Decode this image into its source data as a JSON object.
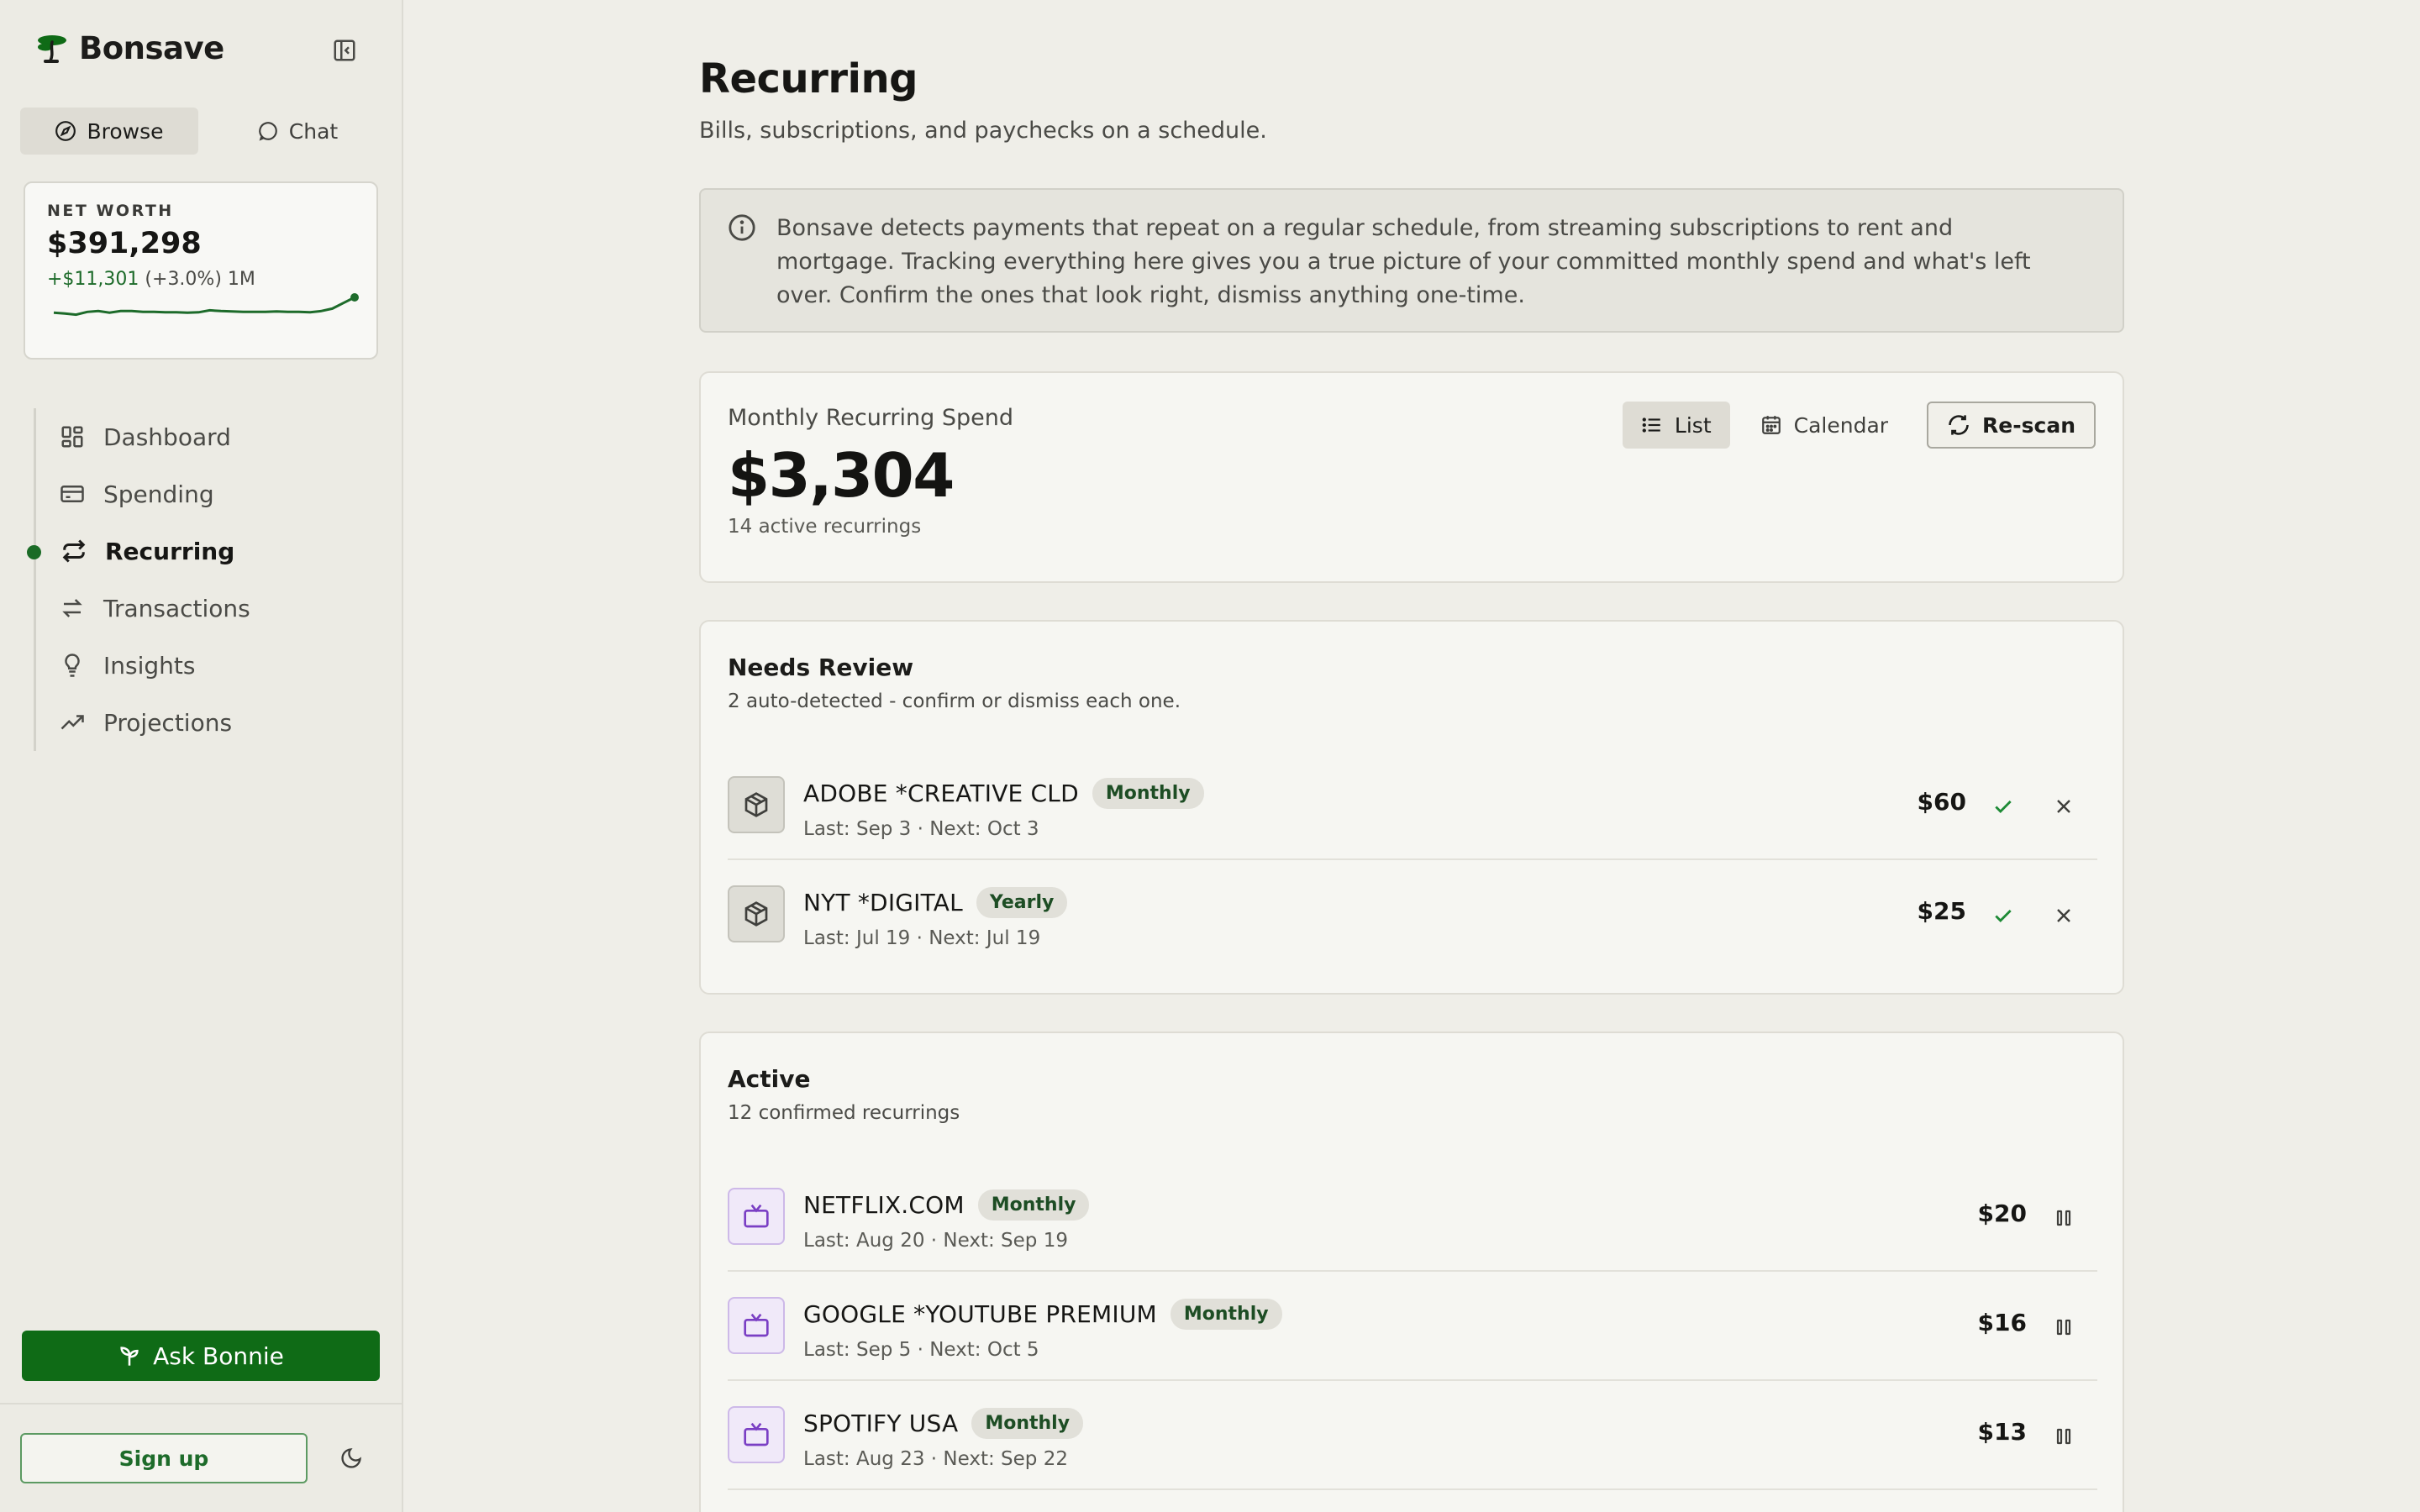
{
  "app": {
    "name": "Bonsave"
  },
  "modes": [
    {
      "label": "Browse",
      "active": true
    },
    {
      "label": "Chat",
      "active": false
    }
  ],
  "net_worth": {
    "label": "NET WORTH",
    "value": "$391,298",
    "change_amount": "+$11,301",
    "change_pct": "(+3.0%)",
    "period": "1M",
    "sparkline": [
      0.62,
      0.6,
      0.57,
      0.64,
      0.66,
      0.62,
      0.66,
      0.66,
      0.64,
      0.64,
      0.63,
      0.63,
      0.62,
      0.63,
      0.68,
      0.66,
      0.65,
      0.64,
      0.64,
      0.64,
      0.65,
      0.64,
      0.64,
      0.63,
      0.66,
      0.72,
      0.86,
      1.0
    ]
  },
  "nav": [
    {
      "label": "Dashboard",
      "icon": "grid-icon",
      "active": false
    },
    {
      "label": "Spending",
      "icon": "credit-card-icon",
      "active": false
    },
    {
      "label": "Recurring",
      "icon": "repeat-icon",
      "active": true
    },
    {
      "label": "Transactions",
      "icon": "arrows-swap-icon",
      "active": false
    },
    {
      "label": "Insights",
      "icon": "lightbulb-icon",
      "active": false
    },
    {
      "label": "Projections",
      "icon": "trending-up-icon",
      "active": false
    }
  ],
  "sidebar_actions": {
    "ask_label": "Ask Bonnie",
    "signup_label": "Sign up"
  },
  "page": {
    "title": "Recurring",
    "subtitle": "Bills, subscriptions, and paychecks on a schedule.",
    "info": "Bonsave detects payments that repeat on a regular schedule, from streaming subscriptions to rent and mortgage. Tracking everything here gives you a true picture of your committed monthly spend and what's left over. Confirm the ones that look right, dismiss anything one-time."
  },
  "summary": {
    "label": "Monthly Recurring Spend",
    "value": "$3,304",
    "count": "14 active recurrings",
    "views": {
      "list": "List",
      "calendar": "Calendar",
      "rescan": "Re-scan"
    }
  },
  "needs_review": {
    "title": "Needs Review",
    "subtitle": "2 auto-detected - confirm or dismiss each one.",
    "items": [
      {
        "name": "ADOBE *CREATIVE CLD",
        "frequency": "Monthly",
        "dates": "Last: Sep 3 · Next: Oct 3",
        "amount": "$60"
      },
      {
        "name": "NYT *DIGITAL",
        "frequency": "Yearly",
        "dates": "Last: Jul 19 · Next: Jul 19",
        "amount": "$25"
      }
    ]
  },
  "active": {
    "title": "Active",
    "subtitle": "12 confirmed recurrings",
    "items": [
      {
        "name": "NETFLIX.COM",
        "frequency": "Monthly",
        "dates": "Last: Aug 20 · Next: Sep 19",
        "amount": "$20"
      },
      {
        "name": "GOOGLE *YOUTUBE PREMIUM",
        "frequency": "Monthly",
        "dates": "Last: Sep 5 · Next: Oct 5",
        "amount": "$16"
      },
      {
        "name": "SPOTIFY USA",
        "frequency": "Monthly",
        "dates": "Last: Aug 23 · Next: Sep 22",
        "amount": "$13"
      }
    ]
  },
  "colors": {
    "accent": "#0f6b16",
    "positive": "#1d6b2a",
    "purple": "#7a3fc4"
  }
}
